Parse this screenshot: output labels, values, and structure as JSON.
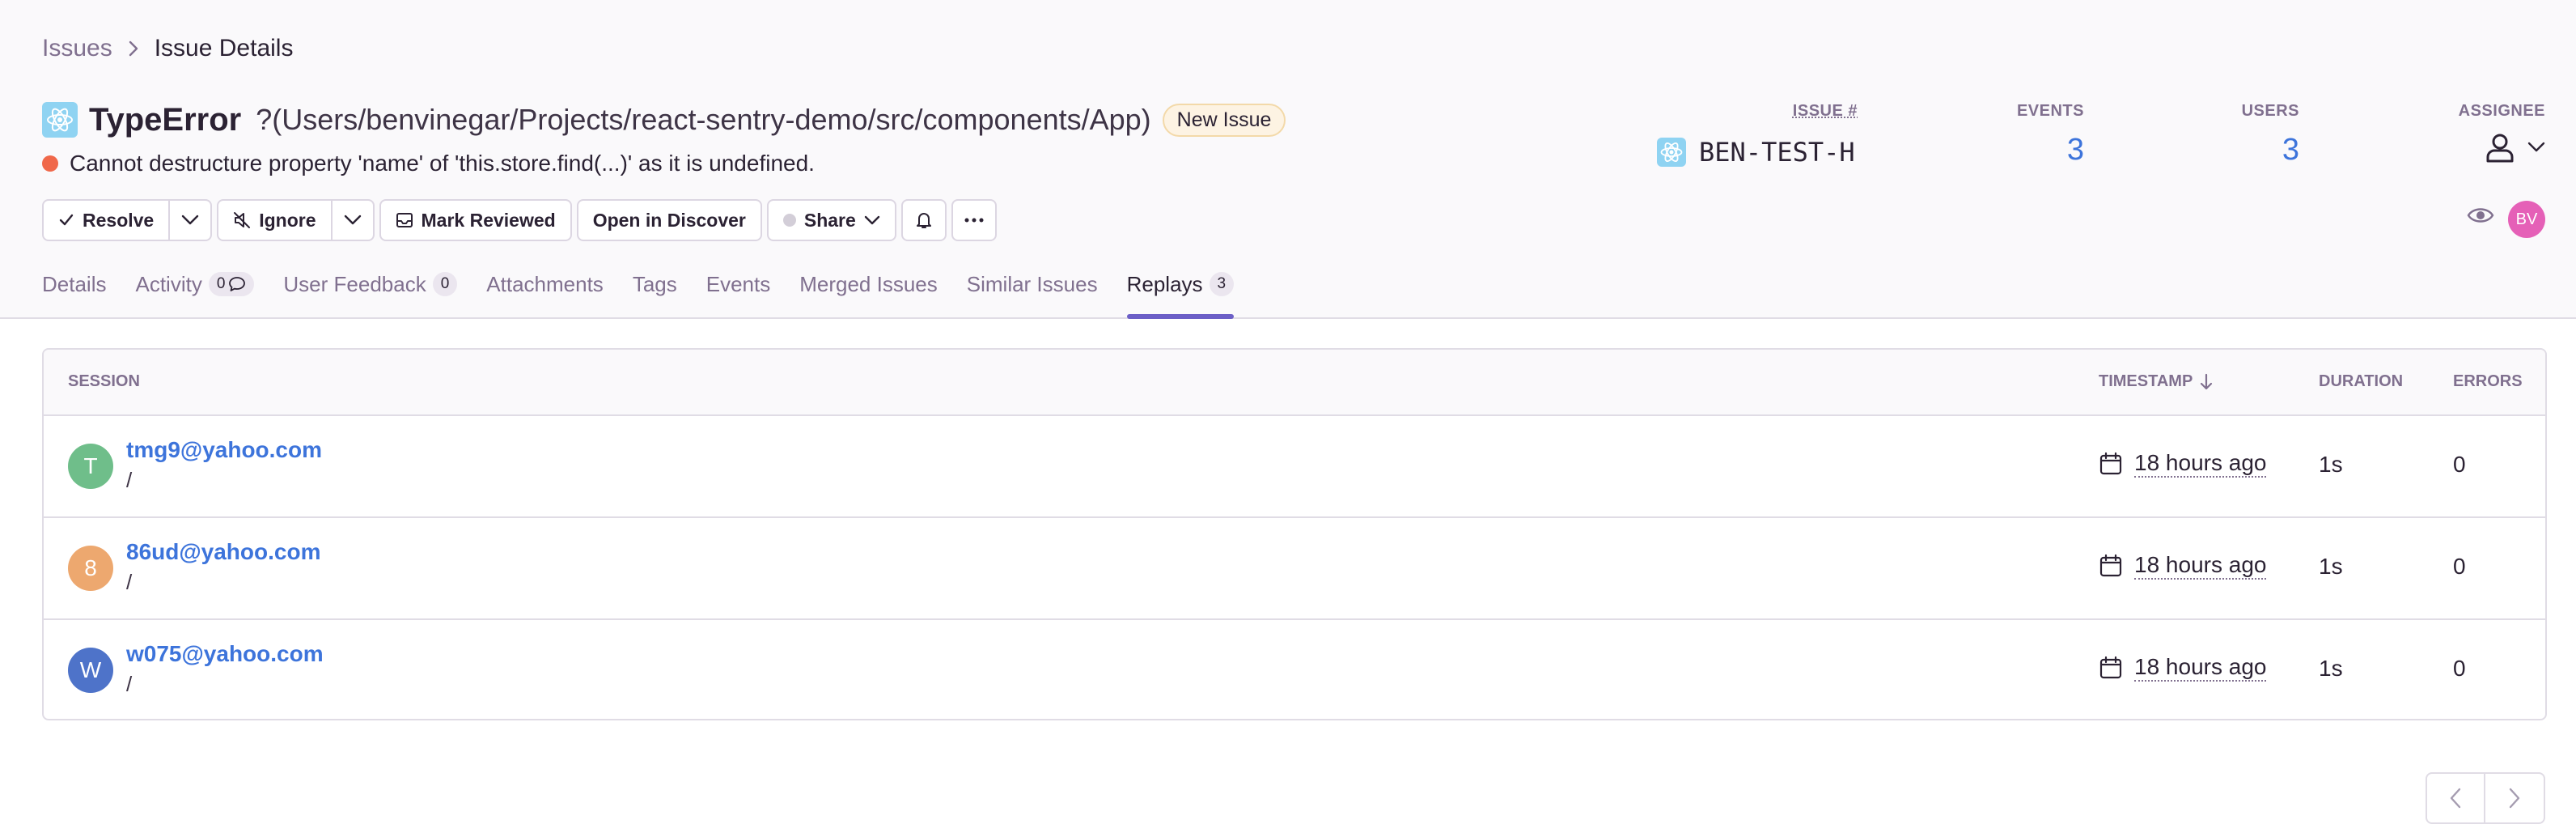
{
  "breadcrumb": {
    "parent": "Issues",
    "current": "Issue Details"
  },
  "issue": {
    "type": "TypeError",
    "culprit": "?(Users/benvinegar/Projects/react-sentry-demo/src/components/App)",
    "badge": "New Issue",
    "message": "Cannot destructure property 'name' of 'this.store.find(...)' as it is undefined.",
    "level_color": "#f0684a",
    "platform_icon": "react-icon"
  },
  "actions": {
    "resolve": "Resolve",
    "ignore": "Ignore",
    "mark_reviewed": "Mark Reviewed",
    "open_in_discover": "Open in Discover",
    "share": "Share"
  },
  "stats": {
    "issue_label": "ISSUE #",
    "issue_id": "BEN-TEST-H",
    "events_label": "EVENTS",
    "events": "3",
    "users_label": "USERS",
    "users": "3",
    "assignee_label": "ASSIGNEE"
  },
  "current_user": {
    "initials": "BV",
    "color": "#e560b7"
  },
  "tabs": [
    {
      "label": "Details"
    },
    {
      "label": "Activity",
      "count": "0"
    },
    {
      "label": "User Feedback",
      "count": "0"
    },
    {
      "label": "Attachments"
    },
    {
      "label": "Tags"
    },
    {
      "label": "Events"
    },
    {
      "label": "Merged Issues"
    },
    {
      "label": "Similar Issues"
    },
    {
      "label": "Replays",
      "count": "3"
    }
  ],
  "active_tab": "Replays",
  "table": {
    "columns": {
      "session": "SESSION",
      "timestamp": "TIMESTAMP",
      "duration": "DURATION",
      "errors": "ERRORS"
    },
    "rows": [
      {
        "initial": "T",
        "avatar_color": "#6fbe8a",
        "email": "tmg9@yahoo.com",
        "url": "/",
        "timestamp": "18 hours ago",
        "duration": "1s",
        "errors": "0"
      },
      {
        "initial": "8",
        "avatar_color": "#eda86f",
        "email": "86ud@yahoo.com",
        "url": "/",
        "timestamp": "18 hours ago",
        "duration": "1s",
        "errors": "0"
      },
      {
        "initial": "W",
        "avatar_color": "#4e73c9",
        "email": "w075@yahoo.com",
        "url": "/",
        "timestamp": "18 hours ago",
        "duration": "1s",
        "errors": "0"
      }
    ]
  }
}
